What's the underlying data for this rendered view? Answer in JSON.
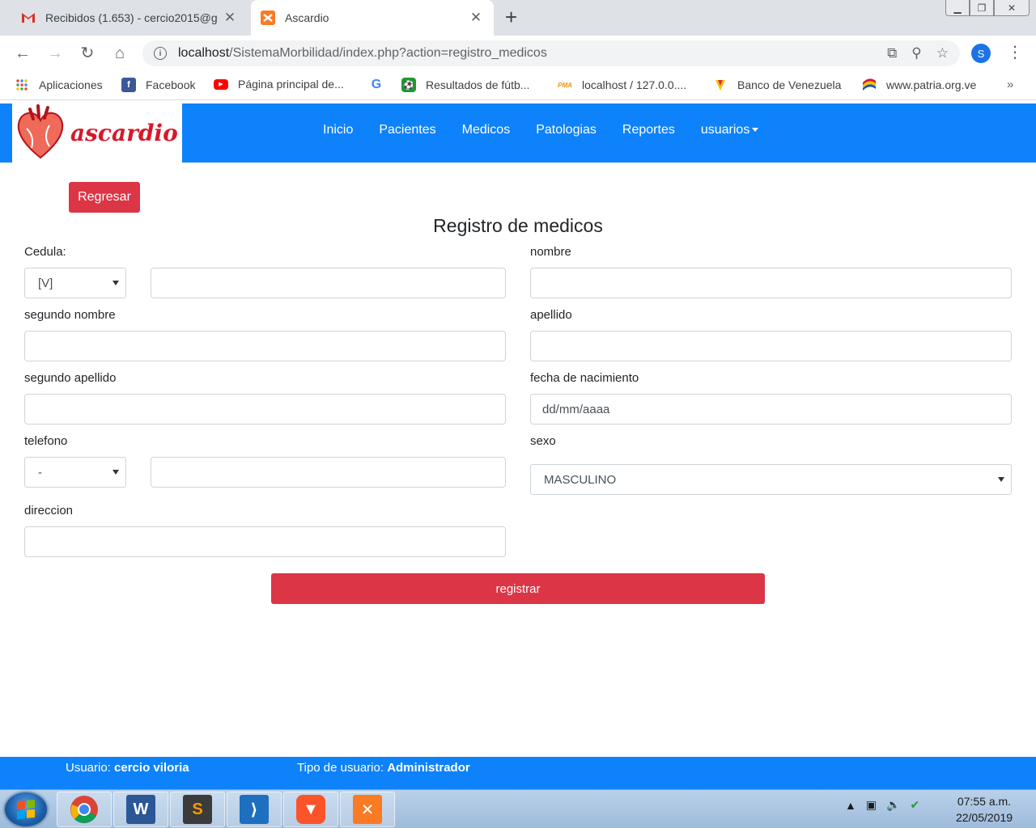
{
  "browser": {
    "tabs": [
      {
        "title": "Recibidos (1.653) - cercio2015@g",
        "icon": "gmail-icon",
        "active": false
      },
      {
        "title": "Ascardio",
        "icon": "xampp-icon",
        "active": true
      }
    ],
    "url_host": "localhost",
    "url_path": "/SistemaMorbilidad/index.php?action=registro_medicos",
    "profile_initial": "S",
    "bookmarks": [
      {
        "label": "Aplicaciones",
        "icon": "apps-grid-icon"
      },
      {
        "label": "Facebook",
        "icon": "facebook-icon"
      },
      {
        "label": "Página principal de...",
        "icon": "youtube-icon"
      },
      {
        "label": "",
        "icon": "google-icon"
      },
      {
        "label": "Resultados de fútb...",
        "icon": "soccer-icon"
      },
      {
        "label": "localhost / 127.0.0....",
        "icon": "phpmyadmin-icon"
      },
      {
        "label": "Banco de Venezuela",
        "icon": "bank-icon"
      },
      {
        "label": "www.patria.org.ve",
        "icon": "patria-icon"
      }
    ],
    "bookmarks_more": "»"
  },
  "site": {
    "brand": "ascardio",
    "nav": [
      "Inicio",
      "Pacientes",
      "Medicos",
      "Patologias",
      "Reportes",
      "usuarios"
    ],
    "brand_color": "#0d82fb"
  },
  "page": {
    "back_label": "Regresar",
    "title": "Registro de medicos",
    "fields": {
      "cedula_label": "Cedula:",
      "cedula_type": "[V]",
      "cedula_value": "",
      "nombre_label": "nombre",
      "nombre_value": "",
      "segundo_nombre_label": "segundo nombre",
      "segundo_nombre_value": "",
      "apellido_label": "apellido",
      "apellido_value": "",
      "segundo_apellido_label": "segundo apellido",
      "segundo_apellido_value": "",
      "fecha_label": "fecha de nacimiento",
      "fecha_placeholder": "dd/mm/aaaa",
      "telefono_label": "telefono",
      "telefono_prefix": "-",
      "telefono_value": "",
      "sexo_label": "sexo",
      "sexo_value": "MASCULINO",
      "direccion_label": "direccion",
      "direccion_value": ""
    },
    "submit_label": "registrar",
    "accent_color": "#dc3545"
  },
  "footer": {
    "user_label": "Usuario:",
    "user_value": "cercio viloria",
    "type_label": "Tipo de usuario:",
    "type_value": "Administrador"
  },
  "taskbar": {
    "apps": [
      "chrome-icon",
      "word-icon",
      "sublime-text-icon",
      "vscode-icon",
      "brave-icon",
      "xampp-icon"
    ],
    "time": "07:55 a.m.",
    "date": "22/05/2019"
  }
}
